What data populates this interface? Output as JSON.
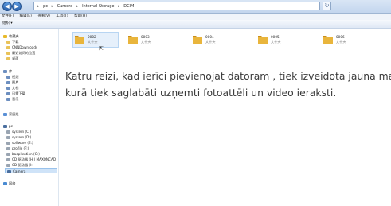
{
  "window": {
    "breadcrumb": [
      "pc",
      "Camera",
      "Internal Storage",
      "DCIM"
    ],
    "back_glyph": "◀",
    "forward_glyph": "▶",
    "refresh_glyph": "↻"
  },
  "menu": [
    "文件(F)",
    "编辑(E)",
    "查看(V)",
    "工具(T)",
    "帮助(H)"
  ],
  "toolbar": {
    "organize_label": "组织 ▾"
  },
  "sidebar": {
    "favorites": [
      {
        "label": "收藏夹",
        "icon": "star-icon"
      },
      {
        "label": "下载",
        "icon": "folder-icon"
      },
      {
        "label": "CNNDownloads",
        "icon": "folder-icon"
      },
      {
        "label": "最近访问的位置",
        "icon": "folder-icon"
      },
      {
        "label": "桌面",
        "icon": "folder-icon"
      }
    ],
    "libraries": [
      {
        "label": "库",
        "icon": "library-icon"
      },
      {
        "label": "视频",
        "icon": "library-icon"
      },
      {
        "label": "图片",
        "icon": "library-icon"
      },
      {
        "label": "文档",
        "icon": "library-icon"
      },
      {
        "label": "迅雷下载",
        "icon": "library-icon"
      },
      {
        "label": "音乐",
        "icon": "library-icon"
      }
    ],
    "homegroup": {
      "label": "家庭组",
      "icon": "homegroup-icon"
    },
    "computer": [
      {
        "label": "pc",
        "icon": "computer-icon"
      },
      {
        "label": "system (C:)",
        "icon": "drive-icon"
      },
      {
        "label": "system (D:)",
        "icon": "drive-icon"
      },
      {
        "label": "software (E:)",
        "icon": "drive-icon"
      },
      {
        "label": "profile (F:)",
        "icon": "drive-icon"
      },
      {
        "label": "baoplication (G:)",
        "icon": "drive-icon"
      },
      {
        "label": "CD 驱动器 (H:) MAXONCAD",
        "icon": "drive-icon"
      },
      {
        "label": "CD 驱动器 (I:)",
        "icon": "drive-icon"
      },
      {
        "label": "Camera",
        "icon": "camera-icon"
      }
    ],
    "network": {
      "label": "网络",
      "icon": "network-icon"
    }
  },
  "folders": [
    {
      "name": "0002",
      "type": "文件夹"
    },
    {
      "name": "0003",
      "type": "文件夹"
    },
    {
      "name": "0004",
      "type": "文件夹"
    },
    {
      "name": "0005",
      "type": "文件夹"
    },
    {
      "name": "0006",
      "type": "文件夹"
    }
  ],
  "caption": {
    "line1": "Katru reizi, kad ierīci pievienojat datoram , tiek izveidota jauna mape,",
    "line2": "kurā tiek saglabāti uzņemti fotoattēli un video ieraksti."
  },
  "colors": {
    "folder": "#e9b53c",
    "folder_dark": "#c98e1c",
    "selection": "#e6f0fb"
  }
}
